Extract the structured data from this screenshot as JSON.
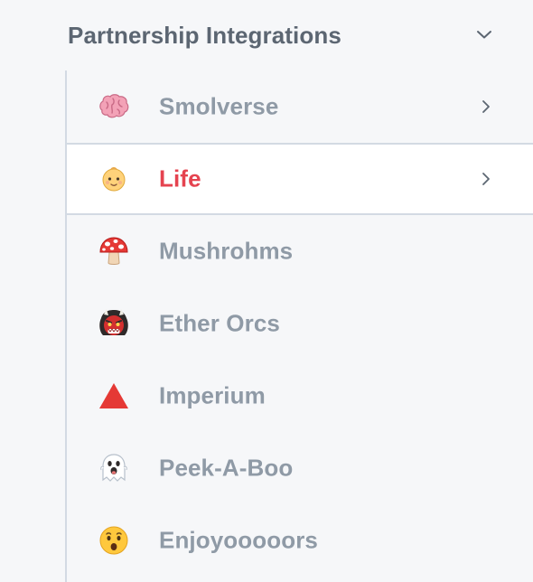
{
  "section": {
    "title": "Partnership Integrations",
    "expanded": true
  },
  "items": [
    {
      "label": "Smolverse",
      "icon": "brain-icon",
      "has_children": true,
      "active": false
    },
    {
      "label": "Life",
      "icon": "baby-icon",
      "has_children": true,
      "active": true
    },
    {
      "label": "Mushrohms",
      "icon": "mushroom-icon",
      "has_children": false,
      "active": false
    },
    {
      "label": "Ether Orcs",
      "icon": "ogre-icon",
      "has_children": false,
      "active": false
    },
    {
      "label": "Imperium",
      "icon": "red-triangle-icon",
      "has_children": false,
      "active": false
    },
    {
      "label": "Peek-A-Boo",
      "icon": "ghost-icon",
      "has_children": false,
      "active": false
    },
    {
      "label": "Enjoyooooors",
      "icon": "hushed-face-icon",
      "has_children": false,
      "active": false
    }
  ],
  "colors": {
    "background": "#f6f7f9",
    "active_background": "#ffffff",
    "divider": "#d3dae3",
    "section_title": "#5c6672",
    "item_label": "#8f9aa6",
    "active_label": "#e5434f"
  }
}
